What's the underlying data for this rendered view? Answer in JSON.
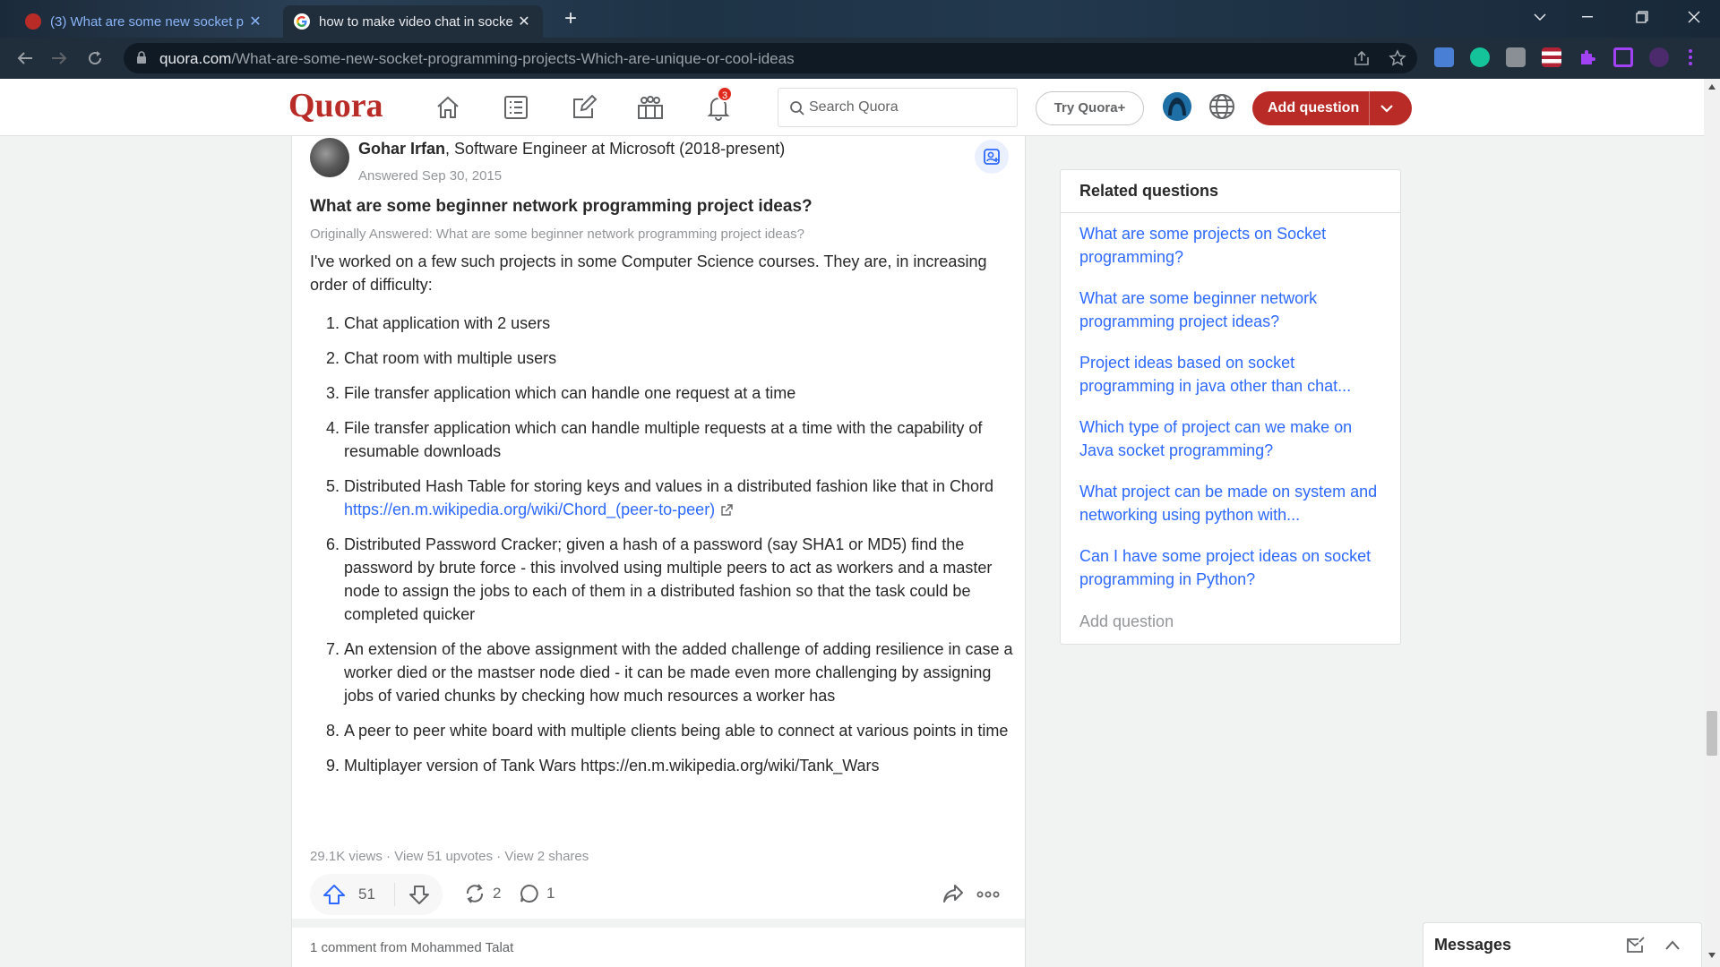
{
  "browser": {
    "tabs": [
      {
        "title": "(3) What are some new socket p"
      },
      {
        "title": "how to make video chat in socke"
      }
    ],
    "url_host": "quora.com",
    "url_path": "/What-are-some-new-socket-programming-projects-Which-are-unique-or-cool-ideas"
  },
  "quora_header": {
    "logo": "Quora",
    "notification_count": "3",
    "search_placeholder": "Search Quora",
    "try_quora_plus": "Try Quora+",
    "add_question": "Add question"
  },
  "answer": {
    "author_name": "Gohar Irfan",
    "author_credential": ", Software Engineer at Microsoft (2018-present)",
    "answered_date": "Answered Sep 30, 2015",
    "question_title": "What are some beginner network programming project ideas?",
    "originally_answered": "Originally Answered: What are some beginner network programming project ideas?",
    "intro": "I've worked on a few such projects in some Computer Science courses. They are, in increasing order of difficulty:",
    "items": [
      {
        "num": "1.",
        "text": "Chat application with 2 users"
      },
      {
        "num": "2.",
        "text": "Chat room with multiple users"
      },
      {
        "num": "3.",
        "text": "File transfer application which can handle one request at a time"
      },
      {
        "num": "4.",
        "text": "File transfer application which can handle multiple requests at a time with the capability of resumable downloads"
      },
      {
        "num": "5.",
        "text": "Distributed Hash Table for storing keys and values in a distributed fashion like that in Chord ",
        "link": "https://en.m.wikipedia.org/wiki/Chord_(peer-to-peer)"
      },
      {
        "num": "6.",
        "text": "Distributed Password Cracker; given a hash of a password (say SHA1 or MD5) find the password by brute force - this involved using multiple peers to act as workers and a master node to assign the jobs to each of them in a distributed fashion so that the task could be completed quicker"
      },
      {
        "num": "7.",
        "text": "An extension of the above assignment with the added challenge of adding resilience in case a worker died or the mastser node died - it can be made even more challenging by assigning jobs of varied chunks by checking how much resources a worker has"
      },
      {
        "num": "8.",
        "text": "A peer to peer white board with multiple clients being able to connect at various points in time"
      },
      {
        "num": "9.",
        "text": "Multiplayer version of Tank Wars https://en.m.wikipedia.org/wiki/Tank_Wars"
      }
    ],
    "stats": "29.1K views · View 51 upvotes · View 2 shares",
    "upvotes": "51",
    "shares": "2",
    "comments": "1",
    "comment_from": "1 comment from Mohammed Talat"
  },
  "related": {
    "heading": "Related questions",
    "questions": [
      "What are some projects on Socket programming?",
      "What are some beginner network programming project ideas?",
      "Project ideas based on socket programming in java other than chat...",
      "Which type of project can we make on Java socket programming?",
      "What project can be made on system and networking using python with...",
      "Can I have some project ideas on socket programming in Python?"
    ],
    "add_question": "Add question"
  },
  "messages": {
    "title": "Messages"
  },
  "colors": {
    "quora_red": "#b92b27",
    "link_blue": "#2e69ff",
    "browser_toolbar": "#202d3b"
  }
}
